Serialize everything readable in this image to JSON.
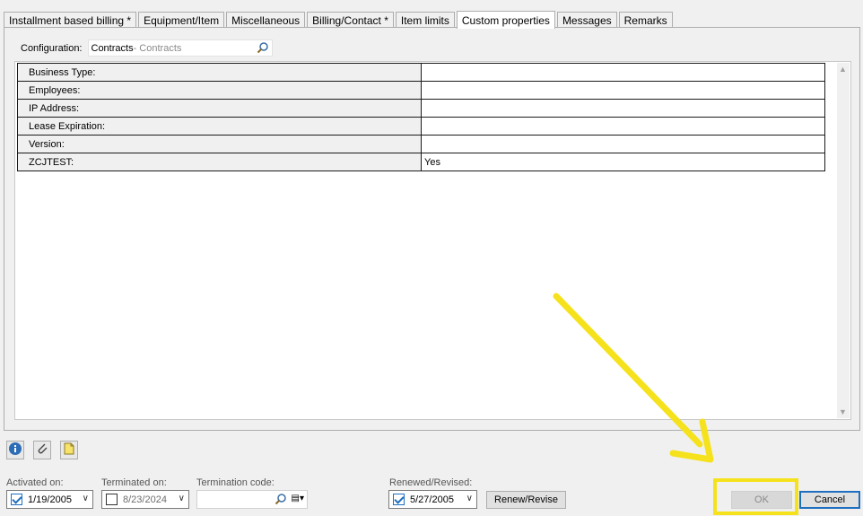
{
  "tabs": [
    {
      "label": "Installment based billing *",
      "active": false
    },
    {
      "label": "Equipment/Item",
      "active": false
    },
    {
      "label": "Miscellaneous",
      "active": false
    },
    {
      "label": "Billing/Contact *",
      "active": false
    },
    {
      "label": "Item limits",
      "active": false
    },
    {
      "label": "Custom properties",
      "active": true
    },
    {
      "label": "Messages",
      "active": false
    },
    {
      "label": "Remarks",
      "active": false
    }
  ],
  "configuration": {
    "label": "Configuration:",
    "value": "Contracts",
    "sub": " - Contracts",
    "icon": "search-icon"
  },
  "properties": [
    {
      "label": "Business Type:",
      "value": ""
    },
    {
      "label": "Employees:",
      "value": ""
    },
    {
      "label": "IP Address:",
      "value": ""
    },
    {
      "label": "Lease Expiration:",
      "value": ""
    },
    {
      "label": "Version:",
      "value": ""
    },
    {
      "label": "ZCJTEST:",
      "value": "Yes"
    }
  ],
  "toolbar": {
    "icons": [
      "info-icon",
      "attachment-icon",
      "note-icon"
    ]
  },
  "footer": {
    "activated": {
      "label": "Activated on:",
      "value": "1/19/2005",
      "checked": true
    },
    "terminated": {
      "label": "Terminated on:",
      "value": "8/23/2024",
      "checked": false
    },
    "termination_code": {
      "label": "Termination code:",
      "value": ""
    },
    "renewed": {
      "label": "Renewed/Revised:",
      "value": "5/27/2005",
      "checked": true
    },
    "renew_button": "Renew/Revise",
    "ok_button": "OK",
    "cancel_button": "Cancel"
  },
  "colors": {
    "highlight": "#f5e21c",
    "arrow": "#f5e21c",
    "accent": "#1e6fbf"
  }
}
